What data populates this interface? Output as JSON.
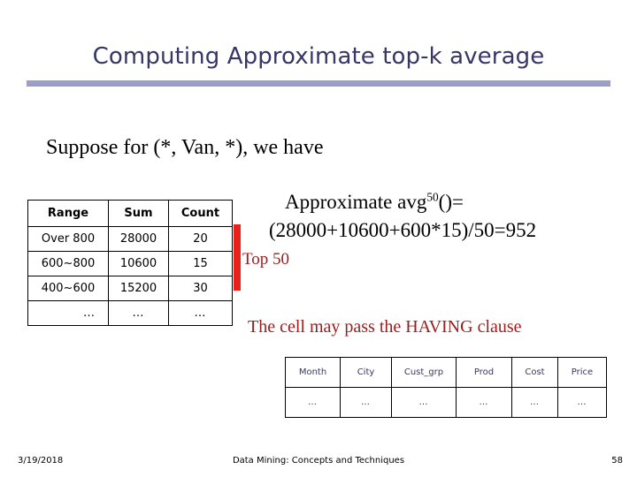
{
  "slide": {
    "title": "Computing Approximate top-k average",
    "suppose_line": "Suppose for (*, Van, *), we have",
    "accent_rule_color": "#9a9ec8",
    "title_color": "#363667",
    "marker_color": "#e8211a",
    "note_color": "#9e1b1b"
  },
  "range_table": {
    "headers": [
      "Range",
      "Sum",
      "Count"
    ],
    "rows": [
      [
        "Over 800",
        "28000",
        "20"
      ],
      [
        "600~800",
        "10600",
        "15"
      ],
      [
        "400~600",
        "15200",
        "30"
      ],
      [
        "…",
        "…",
        "…"
      ]
    ]
  },
  "marker": {
    "label": "Top 50"
  },
  "formula": {
    "line1_prefix": "Approximate avg",
    "line1_sup": "50",
    "line1_suffix": "()=",
    "line2": "(28000+10600+600*15)/50=952"
  },
  "having_note": {
    "text": "The cell may pass the HAVING clause"
  },
  "schema_table": {
    "headers": [
      "Month",
      "City",
      "Cust_grp",
      "Prod",
      "Cost",
      "Price"
    ],
    "rows": [
      [
        "…",
        "…",
        "…",
        "…",
        "…",
        "…"
      ]
    ]
  },
  "footer": {
    "date": "3/19/2018",
    "center": "Data Mining: Concepts and Techniques",
    "page": "58"
  }
}
